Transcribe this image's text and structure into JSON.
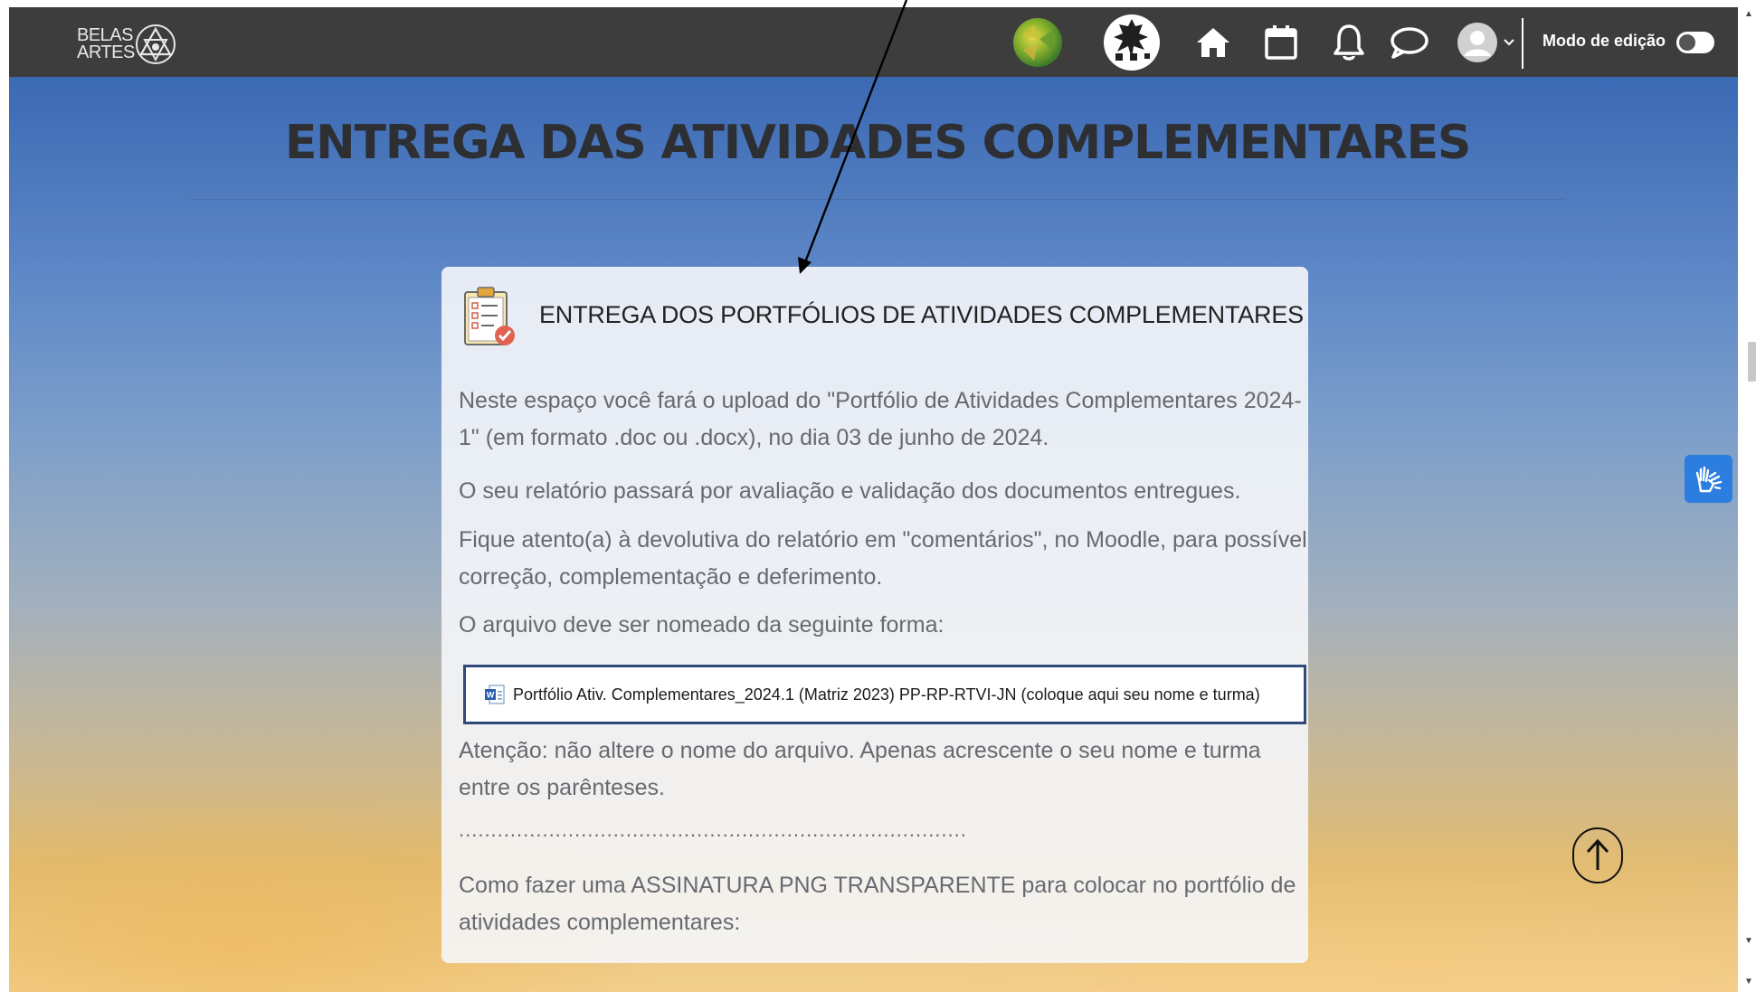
{
  "navbar": {
    "logo_text_line1": "BELAS",
    "logo_text_line2": "ARTES",
    "edit_mode_label": "Modo de edição",
    "edit_mode_on": false,
    "icons": [
      "course-badge-icon",
      "chess-badge-icon",
      "home-icon",
      "calendar-icon",
      "bell-icon",
      "chat-icon",
      "user-avatar-icon",
      "chevron-down-icon"
    ]
  },
  "page": {
    "title": "ENTREGA DAS ATIVIDADES COMPLEMENTARES"
  },
  "card": {
    "title": "ENTREGA DOS PORTFÓLIOS DE ATIVIDADES COMPLEMENTARES",
    "paragraphs": [
      "Neste espaço você fará o upload do \"Portfólio de Atividades Complementares 2024-1\" (em formato .doc ou .docx), no dia 03 de junho de 2024.",
      "O seu relatório passará por avaliação e validação dos documentos entregues.",
      "Fique atento(a) à devolutiva do relatório em \"comentários\", no Moodle, para possível correção, complementação e deferimento.",
      "O arquivo deve ser nomeado da seguinte forma:"
    ],
    "file_name": "Portfólio Ativ. Complementares_2024.1 (Matriz 2023) PP-RP-RTVI-JN (coloque aqui seu nome e turma)",
    "attention": "Atenção: não altere o nome do arquivo. Apenas acrescente o seu nome e turma entre os parênteses.",
    "separator": "...............................................................................",
    "signature_text": "Como fazer uma ASSINATURA PNG TRANSPARENTE para colocar no portfólio de atividades complementares:"
  },
  "colors": {
    "navbar_bg": "#3d3d3d",
    "accessibility_blue": "#2b7de0",
    "file_box_border": "#2f4a7a"
  }
}
